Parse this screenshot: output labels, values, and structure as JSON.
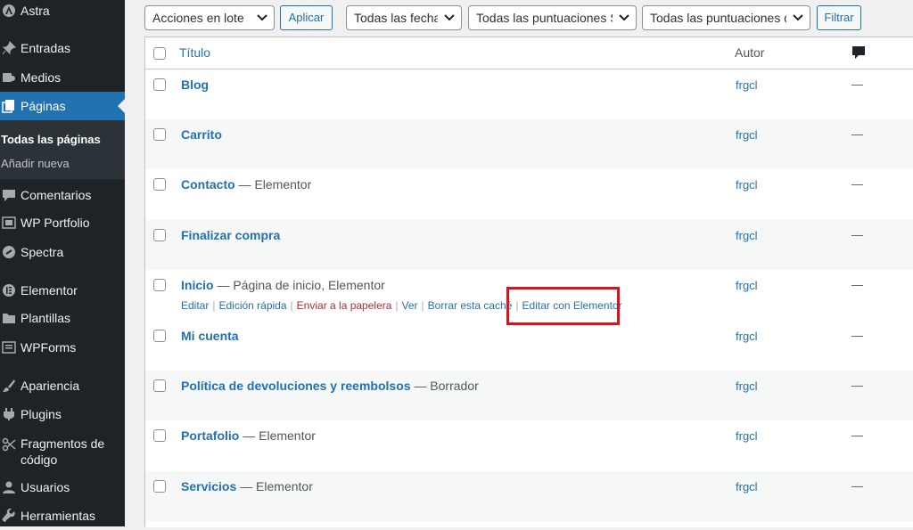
{
  "sidebar": {
    "items": [
      {
        "label": "Astra",
        "icon": "astra-icon"
      },
      {
        "label": "Entradas",
        "icon": "pin-icon"
      },
      {
        "label": "Medios",
        "icon": "media-icon"
      },
      {
        "label": "Páginas",
        "icon": "pages-icon"
      },
      {
        "label": "Comentarios",
        "icon": "comment-icon"
      },
      {
        "label": "WP Portfolio",
        "icon": "portfolio-icon"
      },
      {
        "label": "Spectra",
        "icon": "spectra-icon"
      },
      {
        "label": "Elementor",
        "icon": "elementor-icon"
      },
      {
        "label": "Plantillas",
        "icon": "folder-icon"
      },
      {
        "label": "WPForms",
        "icon": "forms-icon"
      },
      {
        "label": "Apariencia",
        "icon": "brush-icon"
      },
      {
        "label": "Plugins",
        "icon": "plugin-icon"
      },
      {
        "label": "Fragmentos de código",
        "icon": "scissors-icon"
      },
      {
        "label": "Usuarios",
        "icon": "users-icon"
      },
      {
        "label": "Herramientas",
        "icon": "wrench-icon"
      }
    ],
    "submenu": {
      "all_pages": "Todas las páginas",
      "add_new": "Añadir nueva"
    }
  },
  "toolbar": {
    "bulk_actions": "Acciones en lote",
    "apply": "Aplicar",
    "dates": "Todas las fechas",
    "seo_scores": "Todas las puntuaciones SEO",
    "readability": "Todas las puntuaciones de legibilidad",
    "filter": "Filtrar"
  },
  "table": {
    "col_title": "Título",
    "col_author": "Autor",
    "rows": [
      {
        "title": "Blog",
        "state": "",
        "author": "frgcl",
        "comments": "—"
      },
      {
        "title": "Carrito",
        "state": "",
        "author": "frgcl",
        "comments": "—"
      },
      {
        "title": "Contacto",
        "state": " — Elementor",
        "author": "frgcl",
        "comments": "—"
      },
      {
        "title": "Finalizar compra",
        "state": "",
        "author": "frgcl",
        "comments": "—"
      },
      {
        "title": "Inicio",
        "state": " — Página de inicio, Elementor",
        "author": "frgcl",
        "comments": "—"
      },
      {
        "title": "Mi cuenta",
        "state": "",
        "author": "frgcl",
        "comments": "—"
      },
      {
        "title": "Política de devoluciones y reembolsos",
        "state": " — Borrador",
        "author": "frgcl",
        "comments": "—"
      },
      {
        "title": "Portafolio",
        "state": " — Elementor",
        "author": "frgcl",
        "comments": "—"
      },
      {
        "title": "Servicios",
        "state": " — Elementor",
        "author": "frgcl",
        "comments": "—"
      }
    ],
    "row_actions": {
      "edit": "Editar",
      "quick_edit": "Edición rápida",
      "trash": "Enviar a la papelera",
      "view": "Ver",
      "clear_cache": "Borrar esta caché",
      "edit_elementor": "Editar con Elementor"
    }
  },
  "colors": {
    "accent": "#2271b1",
    "sidebar_bg": "#1d2327",
    "highlight": "#d0161e",
    "trash": "#b32d2e"
  }
}
